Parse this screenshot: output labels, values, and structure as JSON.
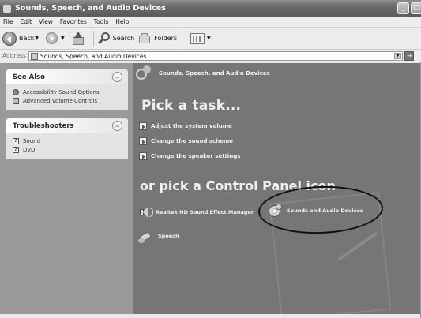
{
  "window": {
    "title": "Sounds, Speech, and Audio Devices"
  },
  "menubar": {
    "items": [
      "File",
      "Edit",
      "View",
      "Favorites",
      "Tools",
      "Help"
    ]
  },
  "toolbar": {
    "back_label": "Back",
    "search_label": "Search",
    "folders_label": "Folders"
  },
  "address": {
    "label": "Address",
    "value": "Sounds, Speech, and Audio Devices"
  },
  "see_also": {
    "title": "See Also",
    "links": [
      "Accessibility Sound Options",
      "Advanced Volume Controls"
    ]
  },
  "troubleshooters": {
    "title": "Troubleshooters",
    "links": [
      "Sound",
      "DVD"
    ]
  },
  "main": {
    "category_title": "Sounds, Speech, and Audio Devices",
    "pick_task_heading": "Pick a task...",
    "tasks": [
      "Adjust the system volume",
      "Change the sound scheme",
      "Change the speaker settings"
    ],
    "pick_icon_heading": "or pick a Control Panel icon",
    "icons": [
      {
        "label": "Realtek HD Sound Effect Manager",
        "icon": "speaker-icon"
      },
      {
        "label": "Sounds and Audio Devices",
        "icon": "sounds-audio-devices-icon",
        "highlighted": true
      },
      {
        "label": "Speech",
        "icon": "speech-icon"
      }
    ]
  }
}
